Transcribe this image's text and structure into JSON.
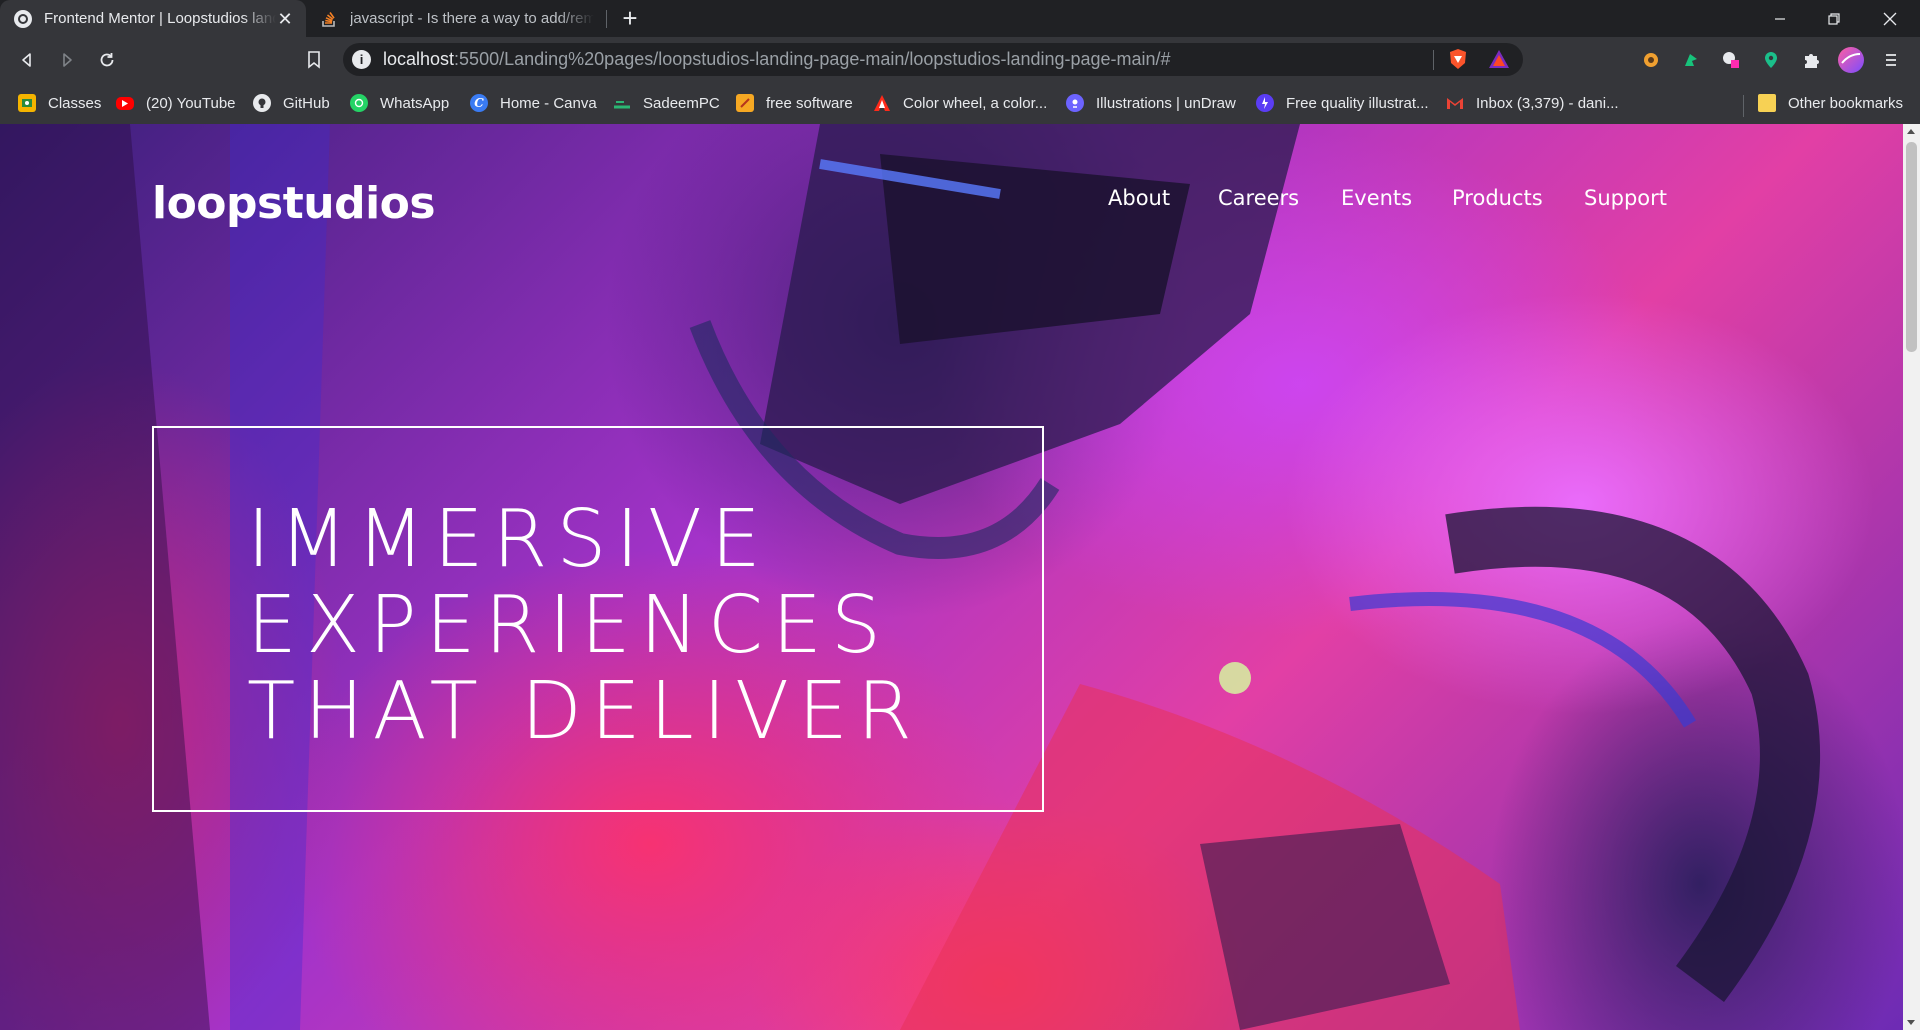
{
  "browser": {
    "tabs": [
      {
        "title": "Frontend Mentor | Loopstudios landing page"
      },
      {
        "title": "javascript - Is there a way to add/remove"
      }
    ],
    "new_tab_symbol": "+",
    "close_symbol": "✕",
    "address_bar": {
      "host": "localhost",
      "path": ":5500/Landing%20pages/loopstudios-landing-page-main/loopstudios-landing-page-main/#"
    },
    "bookmarks": [
      {
        "label": "Classes",
        "icon": "google-classroom-icon",
        "color": "#f4b400"
      },
      {
        "label": "(20) YouTube",
        "icon": "youtube-icon",
        "color": "#ff0000"
      },
      {
        "label": "GitHub",
        "icon": "github-icon",
        "color": "#ffffff"
      },
      {
        "label": "WhatsApp",
        "icon": "whatsapp-icon",
        "color": "#25d366"
      },
      {
        "label": "Home - Canva",
        "icon": "canva-icon",
        "color": "#3a7bf2"
      },
      {
        "label": "SadeemPC",
        "icon": "sadeempc-icon",
        "color": "#2bb673"
      },
      {
        "label": "free software",
        "icon": "folder-software-icon",
        "color": "#f6a823"
      },
      {
        "label": "Color wheel, a color...",
        "icon": "adobe-color-icon",
        "color": "#ff0000"
      },
      {
        "label": "Illustrations | unDraw",
        "icon": "undraw-icon",
        "color": "#6c63ff"
      },
      {
        "label": "Free quality illustrat...",
        "icon": "illustration-icon",
        "color": "#5b3df5"
      },
      {
        "label": "Inbox (3,379) - dani...",
        "icon": "gmail-icon",
        "color": "#ea4335"
      }
    ],
    "other_bookmarks": "Other bookmarks"
  },
  "site": {
    "logo": "loopstudios",
    "nav": [
      "About",
      "Careers",
      "Events",
      "Products",
      "Support"
    ],
    "hero_lines": [
      "IMMERSIVE",
      "EXPERIENCES",
      "THAT DELIVER"
    ]
  }
}
